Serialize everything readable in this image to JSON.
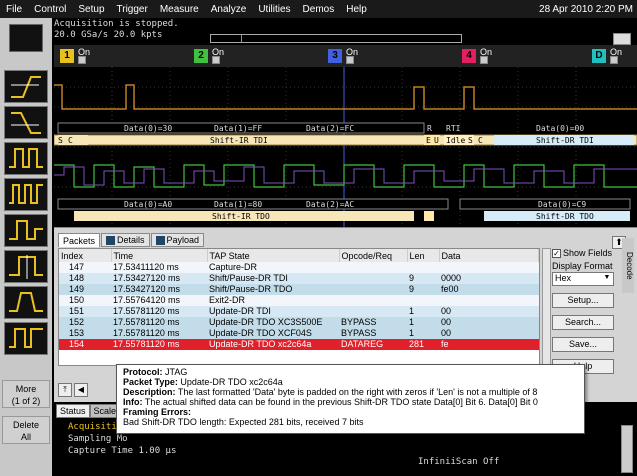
{
  "menu": [
    "File",
    "Control",
    "Setup",
    "Trigger",
    "Measure",
    "Analyze",
    "Utilities",
    "Demos",
    "Help"
  ],
  "datetime": "28 Apr 2010  2:20 PM",
  "acquisition": {
    "status": "Acquisition is stopped.",
    "rate": "20.0 GSa/s   20.0 kpts"
  },
  "channels": [
    {
      "label": "1",
      "on": "On",
      "color": "#e8c020"
    },
    {
      "label": "2",
      "on": "On",
      "color": "#40c040"
    },
    {
      "label": "3",
      "on": "On",
      "color": "#4060e0"
    },
    {
      "label": "4",
      "on": "On",
      "color": "#e02060"
    },
    {
      "label": "D",
      "on": "On",
      "color": "#20c0c0"
    }
  ],
  "waveform": {
    "bus1_upper": [
      "Data(0)=30",
      "Data(1)=FF",
      "Data(2)=FC",
      "R",
      "RTI",
      "Data(0)=00"
    ],
    "bus1_lower": [
      "S",
      "C",
      "Shift-IR TDI",
      "E",
      "U",
      "Idle",
      "S",
      "C",
      "Shift-DR TDI"
    ],
    "bus2_upper": [
      "Data(0)=A0",
      "Data(1)=80",
      "Data(2)=AC",
      "Data(0)=C9"
    ],
    "bus2_lower": [
      "Shift-IR TDO",
      "Shift-DR TDO"
    ],
    "marker_t": "T"
  },
  "packets_panel": {
    "tabs": [
      "Packets",
      "Details",
      "Payload"
    ],
    "columns": [
      "Index",
      "Time",
      "TAP State",
      "Opcode/Req",
      "Len",
      "Data"
    ],
    "rows": [
      {
        "index": "147",
        "time": "17.53411120 ms",
        "state": "Capture-DR",
        "opcode": "",
        "len": "",
        "data": ""
      },
      {
        "index": "148",
        "time": "17.53427120 ms",
        "state": "Shift/Pause-DR TDI",
        "opcode": "",
        "len": "9",
        "data": "0000"
      },
      {
        "index": "149",
        "time": "17.53427120 ms",
        "state": "Shift/Pause-DR TDO",
        "opcode": "",
        "len": "9",
        "data": "fe00"
      },
      {
        "index": "150",
        "time": "17.55764120 ms",
        "state": "Exit2-DR",
        "opcode": "",
        "len": "",
        "data": ""
      },
      {
        "index": "151",
        "time": "17.55781120 ms",
        "state": "Update-DR TDI",
        "opcode": "",
        "len": "1",
        "data": "00"
      },
      {
        "index": "152",
        "time": "17.55781120 ms",
        "state": "Update-DR TDO XC3S500E",
        "opcode": "BYPASS",
        "len": "1",
        "data": "00"
      },
      {
        "index": "153",
        "time": "17.55781120 ms",
        "state": "Update-DR TDO XCF04S",
        "opcode": "BYPASS",
        "len": "1",
        "data": "00"
      },
      {
        "index": "154",
        "time": "17.55781120 ms",
        "state": "Update-DR TDO xc2c64a",
        "opcode": "DATAREG",
        "len": "281",
        "data": "fe"
      }
    ],
    "show_fields": "Show Fields",
    "display_format_label": "Display Format",
    "display_format": "Hex",
    "setup_btn": "Setup...",
    "search_btn": "Search...",
    "save_btn": "Save...",
    "help_btn": "Help",
    "decode_label": "Decode"
  },
  "tooltip": {
    "protocol_label": "Protocol:",
    "protocol": "JTAG",
    "packet_type_label": "Packet Type:",
    "packet_type": "Update-DR TDO xc2c64a",
    "description_label": "Description:",
    "description": "The last formatted 'Data' byte is padded on the right with zeros if 'Len' is not a multiple of 8",
    "info_label": "Info:",
    "info": "The actual shifted data can be found in the previous Shift-DR TDO state Data[0] Bit 6. Data[0] Bit 0",
    "framing_label": "Framing Errors:",
    "framing": "Bad Shift-DR TDO length: Expected 281 bits, received 7 bits"
  },
  "status": {
    "tabs": [
      "Status",
      "Scales"
    ],
    "line1": "Acquisition",
    "line2": "Sampling Mo",
    "line3": "Capture Time    1.00 µs",
    "infiniiscan": "InfiniiScan   Off"
  },
  "sidebar": {
    "more": "More\n(1 of 2)",
    "delete_all": "Delete\nAll"
  }
}
